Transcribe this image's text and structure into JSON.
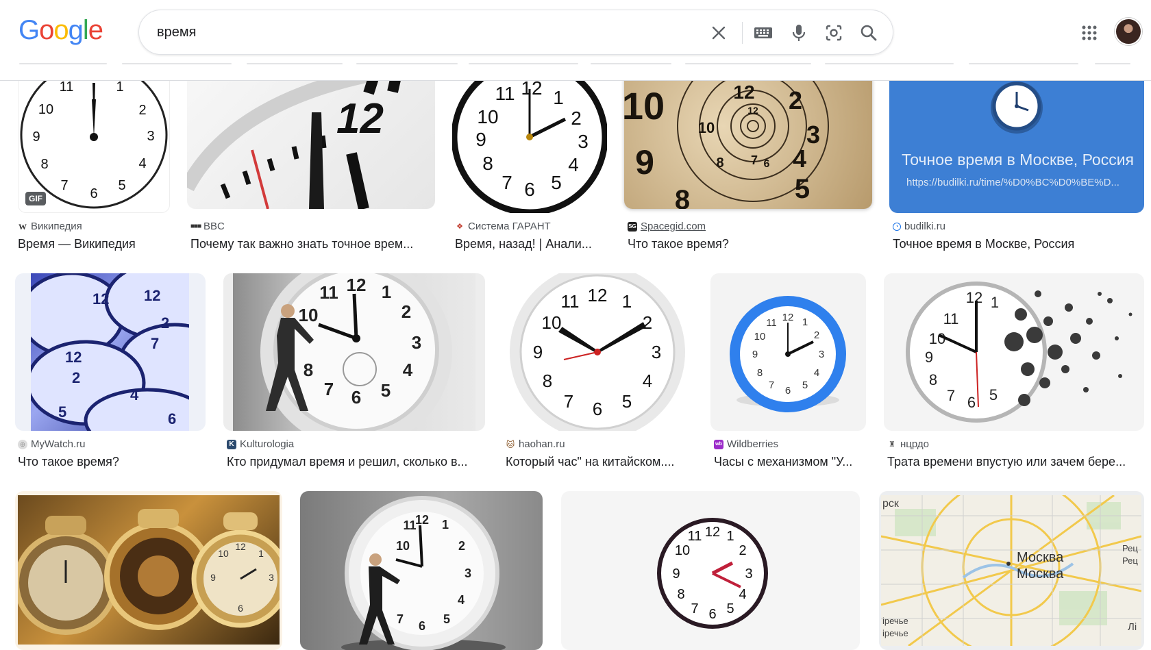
{
  "header": {
    "logo_letters": [
      {
        "ch": "G",
        "color": "#4285F4"
      },
      {
        "ch": "o",
        "color": "#EA4335"
      },
      {
        "ch": "o",
        "color": "#FBBC05"
      },
      {
        "ch": "g",
        "color": "#4285F4"
      },
      {
        "ch": "l",
        "color": "#34A853"
      },
      {
        "ch": "e",
        "color": "#EA4335"
      }
    ],
    "search_value": "время",
    "icons": [
      "clear-icon",
      "keyboard-icon",
      "microphone-icon",
      "lens-icon",
      "search-icon",
      "apps-grid-icon"
    ]
  },
  "results": [
    {
      "source": "Википедия",
      "title": "Время — Википедия",
      "badge": "GIF"
    },
    {
      "source": "BBC",
      "title": "Почему так важно знать точное врем..."
    },
    {
      "source": "Система ГАРАНТ",
      "title": "Время, назад! | Анали..."
    },
    {
      "source": "Spacegid.com",
      "title": "Что такое время?"
    },
    {
      "source": "budilki.ru",
      "title": "Точное время в Москве, Россия",
      "image_title": "Точное время в Москве, Россия",
      "image_url": "https://budilki.ru/time/%D0%BC%D0%BE%D..."
    },
    {
      "source": "MyWatch.ru",
      "title": "Что такое время?"
    },
    {
      "source": "Kulturologia",
      "title": "Кто придумал время и решил, сколько в..."
    },
    {
      "source": "haohan.ru",
      "title": "Который час\" на китайском...."
    },
    {
      "source": "Wildberries",
      "title": "Часы с механизмом \"У..."
    },
    {
      "source": "нцрдо",
      "title": "Трата времени впустую или зачем бере..."
    },
    {},
    {},
    {},
    {
      "map_labels": [
        "Москва",
        "Москва",
        "рск",
        "Рец",
        "Рец",
        "іречье",
        "іречье",
        "Лі"
      ]
    }
  ]
}
